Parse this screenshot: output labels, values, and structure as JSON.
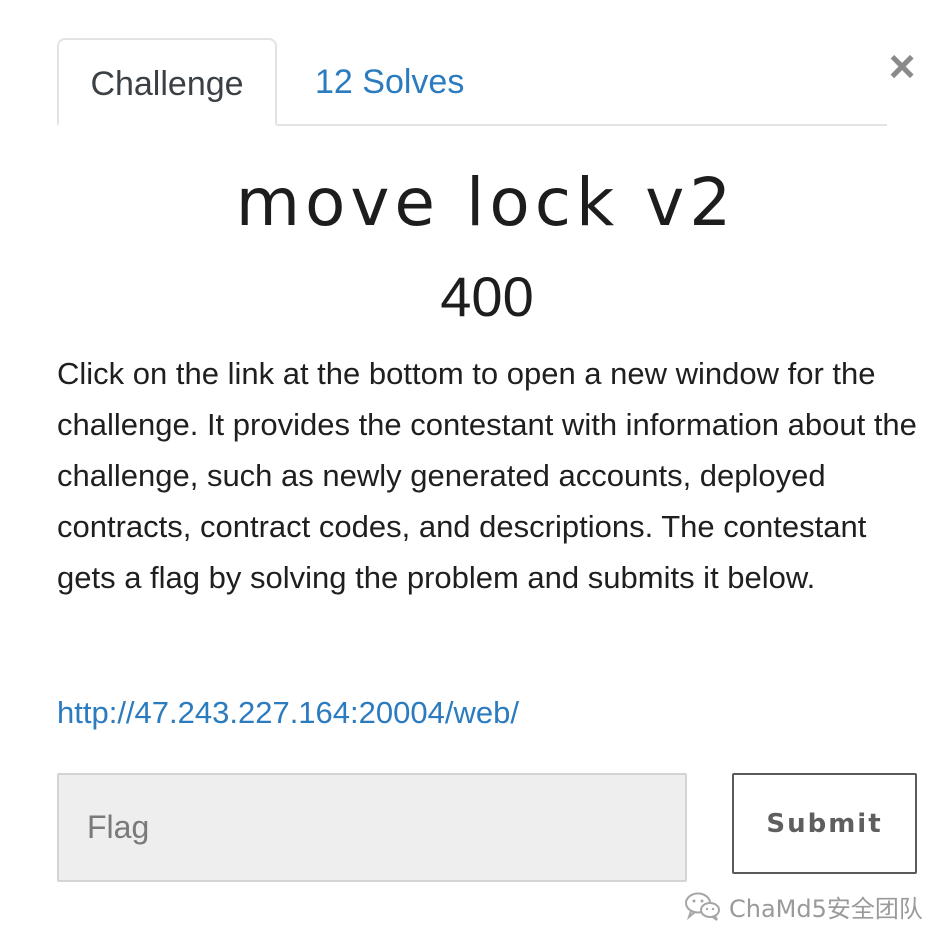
{
  "tabs": [
    {
      "label": "Challenge",
      "active": true
    },
    {
      "label": "12 Solves",
      "active": false
    }
  ],
  "close_symbol": "×",
  "challenge": {
    "name": "move lock v2",
    "points": "400",
    "description": "Click on the link at the bottom to open a new window for the challenge. It provides the contestant with information about the challenge, such as newly generated accounts, deployed contracts, contract codes, and descriptions. The contestant gets a flag by solving the problem and submits it below.",
    "link": "http://47.243.227.164:20004/web/"
  },
  "form": {
    "flag_placeholder": "Flag",
    "flag_value": "",
    "submit_label": "Submit"
  },
  "watermark": {
    "text": "ChaMd5安全团队",
    "icon": "wechat-icon"
  },
  "colors": {
    "link": "#2b7bbf",
    "tab_border": "#e3e3e3",
    "input_bg": "#eeeeee",
    "button_border": "#5a5a5a"
  }
}
